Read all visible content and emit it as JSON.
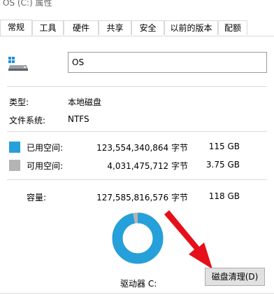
{
  "window": {
    "title": "OS (C:) 属性"
  },
  "tabs": [
    {
      "label": "常规",
      "active": true
    },
    {
      "label": "工具"
    },
    {
      "label": "硬件"
    },
    {
      "label": "共享"
    },
    {
      "label": "安全"
    },
    {
      "label": "以前的版本"
    },
    {
      "label": "配额"
    }
  ],
  "general": {
    "name_value": "OS",
    "type_label": "类型:",
    "type_value": "本地磁盘",
    "fs_label": "文件系统:",
    "fs_value": "NTFS",
    "used": {
      "label": "已用空间:",
      "bytes": "123,554,340,864 字节",
      "size": "115 GB",
      "color": "#26a0da"
    },
    "free": {
      "label": "可用空间:",
      "bytes": "4,031,475,712 字节",
      "size": "3.75 GB",
      "color": "#b4b4b4"
    },
    "capacity": {
      "label": "容量:",
      "bytes": "127,585,816,576 字节",
      "size": "118 GB"
    },
    "used_fraction": 0.968,
    "drive_label": "驱动器 C:",
    "cleanup_button": "磁盘清理(D)"
  }
}
